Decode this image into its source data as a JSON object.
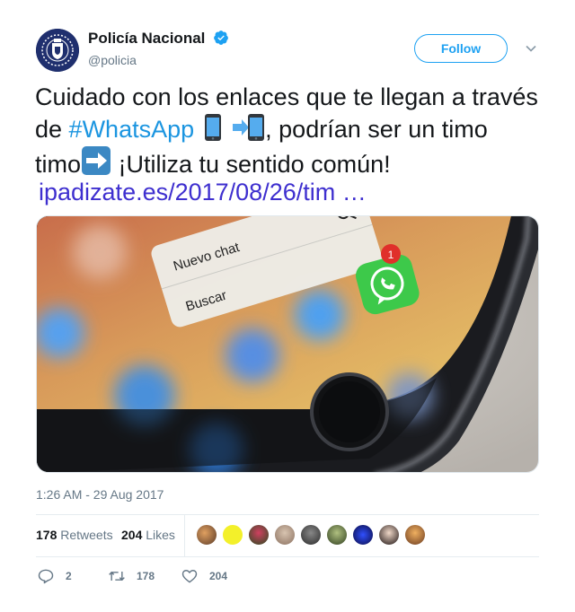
{
  "author": {
    "display_name": "Policía Nacional",
    "handle": "@policia",
    "verified": true
  },
  "follow_label": "Follow",
  "tweet": {
    "text_1": "Cuidado con los enlaces que te llegan a través de ",
    "hashtag": "#WhatsApp",
    "text_2": ", podrían ser un timo",
    "text_3": " ¡Utiliza tu sentido común!",
    "link": "ipadizate.es/2017/08/26/tim …",
    "emojis": [
      "mobile-phone-icon",
      "calling-phone-icon",
      "right-arrow-icon"
    ]
  },
  "media": {
    "menu_item_1": "Nuevo chat",
    "menu_item_2": "Buscar",
    "badge_count": "1"
  },
  "timestamp": "1:26 AM - 29 Aug 2017",
  "stats": {
    "retweets_count": "178",
    "retweets_label": "Retweets",
    "likes_count": "204",
    "likes_label": "Likes"
  },
  "liker_avatars": 9,
  "actions": {
    "reply_count": "2",
    "retweet_count": "178",
    "like_count": "204"
  },
  "colors": {
    "link_blue": "#1da1f2",
    "hashtag_blue": "#1b95e0",
    "url_purple": "#3e2fcf",
    "muted_gray": "#657786"
  }
}
